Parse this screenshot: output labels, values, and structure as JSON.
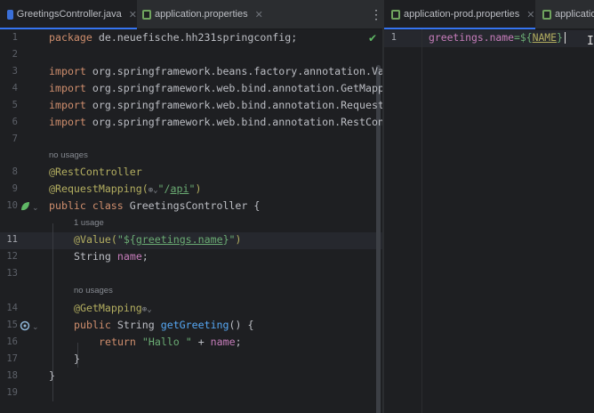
{
  "left_tabs": [
    {
      "label": "GreetingsController.java",
      "icon": "java-class-icon",
      "active": true
    },
    {
      "label": "application.properties",
      "icon": "properties-icon",
      "active": false
    }
  ],
  "right_tabs": [
    {
      "label": "application-prod.properties",
      "icon": "properties-icon",
      "active": true
    },
    {
      "label": "applicatio",
      "icon": "properties-icon",
      "active": false
    }
  ],
  "left_lines": [
    {
      "num": "1",
      "code": "package de.neuefische.hh231springconfig;"
    },
    {
      "num": "2",
      "code": ""
    },
    {
      "num": "3",
      "code": "import org.springframework.beans.factory.annotation.Va"
    },
    {
      "num": "4",
      "code": "import org.springframework.web.bind.annotation.GetMapp"
    },
    {
      "num": "5",
      "code": "import org.springframework.web.bind.annotation.Request"
    },
    {
      "num": "6",
      "code": "import org.springframework.web.bind.annotation.RestCon"
    },
    {
      "num": "7",
      "code": ""
    },
    {
      "num": "8",
      "code": "@RestController"
    },
    {
      "num": "9",
      "code": "@RequestMapping(\"/api\")"
    },
    {
      "num": "10",
      "code": "public class GreetingsController {"
    },
    {
      "num": "11",
      "code": "@Value(\"${greetings.name}\")"
    },
    {
      "num": "12",
      "code": "String name;"
    },
    {
      "num": "13",
      "code": ""
    },
    {
      "num": "14",
      "code": "@GetMapping"
    },
    {
      "num": "15",
      "code": "public String getGreeting() {"
    },
    {
      "num": "16",
      "code": "return \"Hallo \" + name;"
    },
    {
      "num": "17",
      "code": "}"
    },
    {
      "num": "18",
      "code": "}"
    },
    {
      "num": "19",
      "code": ""
    }
  ],
  "hints": {
    "no_usages_1": "no usages",
    "one_usage": "1 usage",
    "no_usages_2": "no usages"
  },
  "right_lines": [
    {
      "num": "1",
      "key": "greetings.name",
      "eq": "=${",
      "placeholder": "NAME",
      "close": "}"
    }
  ],
  "colors": {
    "background": "#1e1f22",
    "keyword": "#cf8e6d",
    "annotation": "#b3ae60",
    "string": "#6aab73",
    "field": "#c77dbb",
    "method": "#56a8f5",
    "accent": "#3574f0"
  }
}
